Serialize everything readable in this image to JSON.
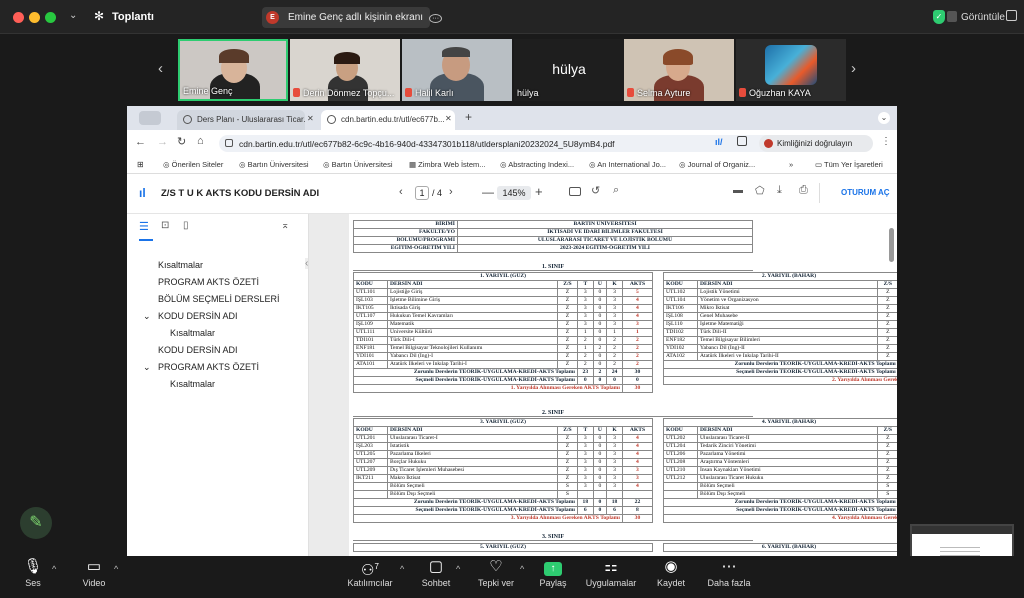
{
  "zoom": {
    "title": "Toplantı",
    "share_label": "Emine Genç adlı kişinin ekranı",
    "share_badge": "E",
    "view_label": "Görüntüle",
    "participants": [
      {
        "name": "Emine Genç",
        "muted": false,
        "active": true
      },
      {
        "name": "Derin Dönmez Topçu...",
        "muted": true,
        "active": false
      },
      {
        "name": "Halil Karlı",
        "muted": true,
        "active": false
      },
      {
        "name": "hülya",
        "center_text": "hülya",
        "muted": false,
        "active": false
      },
      {
        "name": "Selma Ayture",
        "muted": true,
        "active": false
      },
      {
        "name": "Oğuzhan KAYA",
        "muted": true,
        "active": false
      }
    ],
    "toolbar": {
      "mic": "Ses",
      "video": "Video",
      "participants": "Katılımcılar",
      "participants_count": "7",
      "chat": "Sohbet",
      "react": "Tepki ver",
      "share": "Paylaş",
      "apps": "Uygulamalar",
      "record": "Kaydet",
      "more": "Daha fazla"
    }
  },
  "browser": {
    "tabs": [
      {
        "label": "Ders Planı - Uluslararası Ticar..."
      },
      {
        "label": "cdn.bartin.edu.tr/utl/ec677b..."
      }
    ],
    "url": "cdn.bartin.edu.tr/utl/ec677b82-6c9c-4b16-940d-43347301b118/utldersplani20232024_5U8ymB4.pdf",
    "verify": "Kimliğinizi doğrulayın",
    "bookmarks": [
      "Önerilen Siteler",
      "Bartın Üniversitesi",
      "Bartın Üniversitesi",
      "Zimbra Web İstem...",
      "Abstracting Indexi...",
      "An International Jo...",
      "Journal of Organiz..."
    ],
    "bookmarks_more": "»",
    "all_bookmarks": "Tüm Yer İşaretleri"
  },
  "pdf": {
    "title": "Z/S T U K AKTS KODU DERSİN ADI",
    "page_current": "1",
    "page_total": "/ 4",
    "zoom": "145%",
    "signin": "OTURUM AÇ",
    "outline": [
      {
        "label": "Kısaltmalar",
        "indent": 1
      },
      {
        "label": "PROGRAM AKTS ÖZETİ",
        "indent": 1
      },
      {
        "label": "BÖLÜM SEÇMELİ DERSLERİ",
        "indent": 1
      },
      {
        "label": "KODU DERSİN ADI",
        "indent": 0,
        "expand": "⌄"
      },
      {
        "label": "Kısaltmalar",
        "indent": 2
      },
      {
        "label": "KODU DERSİN ADI",
        "indent": 1
      },
      {
        "label": "PROGRAM AKTS ÖZETİ",
        "indent": 0,
        "expand": "⌄"
      },
      {
        "label": "Kısaltmalar",
        "indent": 2
      }
    ]
  },
  "doc": {
    "header_rows": [
      [
        "BİRİMİ",
        "BARTIN ÜNİVERSİTESİ"
      ],
      [
        "FAKÜLTE/YO",
        "İKTİSADİ VE İDARİ BİLİMLER FAKÜLTESİ"
      ],
      [
        "BÖLÜMÜ/PROGRAMI",
        "ULUSLARARASI TİCARET VE LOJİSTİK BÖLÜMÜ"
      ],
      [
        "EĞİTİM-ÖĞRETİM YILI",
        "2023-2024 EĞİTİM-ÖĞRETİM YILI"
      ]
    ],
    "col_headers": [
      "KODU",
      "DERSİN ADI",
      "Z/S",
      "T",
      "U",
      "K",
      "AKTS"
    ],
    "years": [
      {
        "title": "1. SINIF",
        "left_title": "1. YARIYIL (GÜZ)",
        "right_title": "2. YARIYIL (BAHAR)",
        "left": [
          [
            "UTL101",
            "Lojistiğe Giriş",
            "Z",
            "3",
            "0",
            "3",
            "5"
          ],
          [
            "İŞL103",
            "İşletme Bilimine Giriş",
            "Z",
            "3",
            "0",
            "3",
            "4"
          ],
          [
            "İKT105",
            "İktisada Giriş",
            "Z",
            "3",
            "0",
            "3",
            "4"
          ],
          [
            "UTL107",
            "Hukukun Temel Kavramları",
            "Z",
            "3",
            "0",
            "3",
            "4"
          ],
          [
            "İŞL109",
            "Matematik",
            "Z",
            "3",
            "0",
            "3",
            "3"
          ],
          [
            "UTL111",
            "Üniversite Kültürü",
            "Z",
            "1",
            "0",
            "1",
            "1"
          ],
          [
            "TDİ101",
            "Türk Dili-I",
            "Z",
            "2",
            "0",
            "2",
            "2"
          ],
          [
            "ENF181",
            "Temel Bilgisayar Teknolojileri Kullanımı",
            "Z",
            "1",
            "2",
            "2",
            "2"
          ],
          [
            "YDİ101",
            "Yabancı Dil (İng)-I",
            "Z",
            "2",
            "0",
            "2",
            "2"
          ],
          [
            "ATA101",
            "Atatürk İlkeleri ve İnkılap Tarihi-I",
            "Z",
            "2",
            "0",
            "2",
            "2"
          ]
        ],
        "right": [
          [
            "UTL102",
            "Lojistik Yönetimi",
            "Z",
            "3"
          ],
          [
            "UTL104",
            "Yönetim ve Organizasyon",
            "Z",
            "3"
          ],
          [
            "İKT106",
            "Mikro İktisat",
            "Z",
            "3"
          ],
          [
            "İŞL108",
            "Genel Muhasebe",
            "Z",
            "3"
          ],
          [
            "İŞL110",
            "İşletme Matematiği",
            "Z",
            "3"
          ],
          [
            "TDİ102",
            "Türk Dili-II",
            "Z",
            "2"
          ],
          [
            "ENF182",
            "Temel Bilgisayar Bilimleri",
            "Z",
            "1"
          ],
          [
            "YDİ102",
            "Yabancı Dil (İng)-II",
            "Z",
            "2"
          ],
          [
            "ATA102",
            "Atatürk İlkeleri ve İnkılap Tarihi-II",
            "Z",
            "2"
          ]
        ],
        "left_mandatory": [
          "Zorunlu Derslerin TEORİK-UYGULAMA-KREDİ-AKTS Toplamı",
          "23",
          "2",
          "24",
          "30"
        ],
        "left_elective": [
          "Seçmeli Derslerin TEORİK-UYGULAMA-KREDİ-AKTS Toplamı",
          "0",
          "0",
          "0",
          "0"
        ],
        "left_required": [
          "1. Yarıyılda Alınması Gereken AKTS Toplamı",
          "30"
        ],
        "right_mandatory": [
          "Zorunlu Derslerin TEORİK-UYGULAMA-KREDİ-AKTS Toplamı",
          "23"
        ],
        "right_elective": [
          "Seçmeli Derslerin TEORİK-UYGULAMA-KREDİ-AKTS Toplamı",
          "0"
        ],
        "right_required": [
          "2. Yarıyılda Alınması Gereken Ak"
        ]
      },
      {
        "title": "2. SINIF",
        "left_title": "3. YARIYIL (GÜZ)",
        "right_title": "4. YARIYIL (BAHAR)",
        "left": [
          [
            "UTL201",
            "Uluslararası Ticaret-I",
            "Z",
            "3",
            "0",
            "3",
            "4"
          ],
          [
            "İŞL203",
            "İstatistik",
            "Z",
            "3",
            "0",
            "3",
            "4"
          ],
          [
            "UTL205",
            "Pazarlama İlkeleri",
            "Z",
            "3",
            "0",
            "3",
            "4"
          ],
          [
            "UTL207",
            "Borçlar Hukuku",
            "Z",
            "3",
            "0",
            "3",
            "4"
          ],
          [
            "UTL209",
            "Dış Ticaret İşlemleri Muhasebesi",
            "Z",
            "3",
            "0",
            "3",
            "3"
          ],
          [
            "İKT211",
            "Makro İktisat",
            "Z",
            "3",
            "0",
            "3",
            "3"
          ],
          [
            "",
            "Bölüm Seçmeli",
            "S",
            "3",
            "0",
            "3",
            "4"
          ],
          [
            "",
            "Bölüm Dışı Seçmeli",
            "S",
            "",
            "",
            "",
            ""
          ]
        ],
        "right": [
          [
            "UTL202",
            "Uluslararası Ticaret-II",
            "Z",
            "3"
          ],
          [
            "UTL204",
            "Tedarik Zinciri Yönetimi",
            "Z",
            "3"
          ],
          [
            "UTL206",
            "Pazarlama Yönetimi",
            "Z",
            "3"
          ],
          [
            "UTL208",
            "Araştırma Yöntemleri",
            "Z",
            "3"
          ],
          [
            "UTL210",
            "İnsan Kaynakları Yönetimi",
            "Z",
            "3"
          ],
          [
            "UTL212",
            "Uluslararası Ticaret Hukuku",
            "Z",
            "3"
          ],
          [
            "",
            "Bölüm Seçmeli",
            "S",
            "3"
          ],
          [
            "",
            "Bölüm Dışı Seçmeli",
            "S",
            ""
          ]
        ],
        "left_mandatory": [
          "Zorunlu Derslerin TEORİK-UYGULAMA-KREDİ-AKTS Toplamı",
          "18",
          "0",
          "18",
          "22"
        ],
        "left_elective": [
          "Seçmeli Derslerin TEORİK-UYGULAMA-KREDİ-AKTS Toplamı",
          "6",
          "0",
          "6",
          "8"
        ],
        "left_required": [
          "3. Yarıyılda Alınması Gereken AKTS Toplamı",
          "30"
        ],
        "right_mandatory": [
          "Zorunlu Derslerin TEORİK-UYGULAMA-KREDİ-AKTS Toplamı",
          "18"
        ],
        "right_elective": [
          "Seçmeli Derslerin TEORİK-UYGULAMA-KREDİ-AKTS Toplamı",
          "6"
        ],
        "right_required": [
          "4. Yarıyılda Alınması Gereken Ak"
        ]
      }
    ],
    "third": {
      "title": "3. SINIF",
      "left_title": "5. YARIYIL (GÜZ)",
      "right_title": "6. YARIYIL (BAHAR)"
    }
  },
  "colors": {
    "accent": "#1a73e8",
    "red": "#c0392b",
    "green_border": "#2ecc71"
  }
}
